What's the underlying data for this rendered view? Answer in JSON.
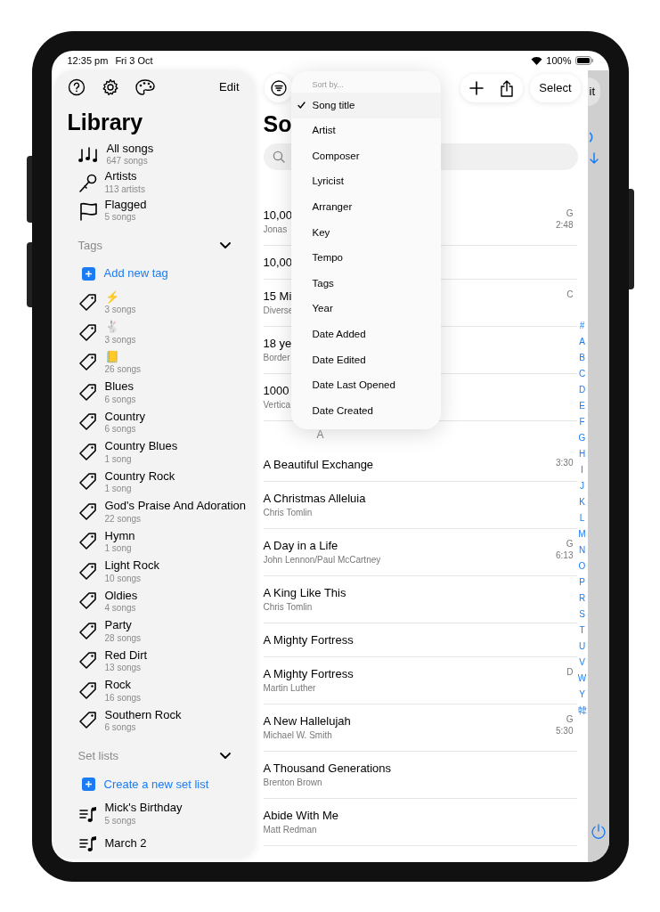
{
  "status_bar": {
    "time": "12:35 pm",
    "date": "Fri 3 Oct",
    "battery": "100%"
  },
  "sidebar": {
    "edit": "Edit",
    "title": "Library",
    "library_items": [
      {
        "kind": "songs",
        "label": "All songs",
        "sub": "647 songs"
      },
      {
        "kind": "artists",
        "label": "Artists",
        "sub": "113 artists"
      },
      {
        "kind": "flag",
        "label": "Flagged",
        "sub": "5 songs"
      }
    ],
    "tags": {
      "header": "Tags",
      "expanded": true,
      "add": "Add new tag",
      "items": [
        {
          "label": "⚡",
          "sub": "3 songs"
        },
        {
          "label": "🐇",
          "sub": "3 songs"
        },
        {
          "label": "📒",
          "sub": "26 songs"
        },
        {
          "label": "Blues",
          "sub": "6 songs"
        },
        {
          "label": "Country",
          "sub": "6 songs"
        },
        {
          "label": "Country Blues",
          "sub": "1 song"
        },
        {
          "label": "Country Rock",
          "sub": "1 song"
        },
        {
          "label": "God's Praise And Adoration",
          "sub": "22 songs"
        },
        {
          "label": "Hymn",
          "sub": "1 song"
        },
        {
          "label": "Light Rock",
          "sub": "10 songs"
        },
        {
          "label": "Oldies",
          "sub": "4 songs"
        },
        {
          "label": "Party",
          "sub": "28 songs"
        },
        {
          "label": "Red Dirt",
          "sub": "13 songs"
        },
        {
          "label": "Rock",
          "sub": "16 songs"
        },
        {
          "label": "Southern Rock",
          "sub": "6 songs"
        }
      ]
    },
    "set_lists": {
      "header": "Set lists",
      "expanded": true,
      "add": "Create a new set list",
      "items": [
        {
          "label": "Mick's Birthday",
          "sub": "5 songs"
        },
        {
          "label": "March 2"
        }
      ]
    }
  },
  "main": {
    "title": "So",
    "select": "Select",
    "sort_menu": {
      "header": "Sort by...",
      "items": [
        {
          "label": "Song title",
          "selected": true
        },
        {
          "label": "Artist",
          "selected": false
        },
        {
          "label": "Composer",
          "selected": false
        },
        {
          "label": "Lyricist",
          "selected": false
        },
        {
          "label": "Arranger",
          "selected": false
        },
        {
          "label": "Key",
          "selected": false
        },
        {
          "label": "Tempo",
          "selected": false
        },
        {
          "label": "Tags",
          "selected": false
        },
        {
          "label": "Year",
          "selected": false
        },
        {
          "label": "Date Added",
          "selected": false
        },
        {
          "label": "Date Edited",
          "selected": false
        },
        {
          "label": "Date Last Opened",
          "selected": false
        },
        {
          "label": "Date Created",
          "selected": false
        }
      ]
    },
    "sections": [
      {
        "rows": [
          {
            "title": "10,00",
            "sub": "Jonas",
            "key": "G",
            "time": "2:48"
          },
          {
            "title": "10,00"
          },
          {
            "title": "15 Mi",
            "sub": "Diverse",
            "key": "C"
          },
          {
            "title": "18 ye",
            "sub": "Border"
          },
          {
            "title": "1000",
            "sub": "Vertica"
          }
        ]
      },
      {
        "header": "A",
        "rows": [
          {
            "title": "A Beautiful Exchange",
            "time": "3:30"
          },
          {
            "title": "A Christmas Alleluia",
            "sub": "Chris Tomlin"
          },
          {
            "title": "A Day in a Life",
            "sub": "John Lennon/Paul McCartney",
            "key": "G",
            "time": "6:13"
          },
          {
            "title": "A King Like This",
            "sub": "Chris Tomlin"
          },
          {
            "title": "A Mighty Fortress"
          },
          {
            "title": "A Mighty Fortress",
            "sub": "Martin Luther",
            "key": "D"
          },
          {
            "title": "A New Hallelujah",
            "sub": "Michael W. Smith",
            "key": "G",
            "time": "5:30"
          },
          {
            "title": "A Thousand Generations",
            "sub": "Brenton Brown"
          },
          {
            "title": "Abide With Me",
            "sub": "Matt Redman"
          }
        ]
      }
    ],
    "index": [
      "#",
      "A",
      "B",
      "C",
      "D",
      "E",
      "F",
      "G",
      "H",
      "I",
      "J",
      "K",
      "L",
      "M",
      "N",
      "O",
      "P",
      "R",
      "S",
      "T",
      "U",
      "V",
      "W",
      "Y",
      "韓"
    ]
  },
  "right_panel": {
    "button": "it"
  }
}
